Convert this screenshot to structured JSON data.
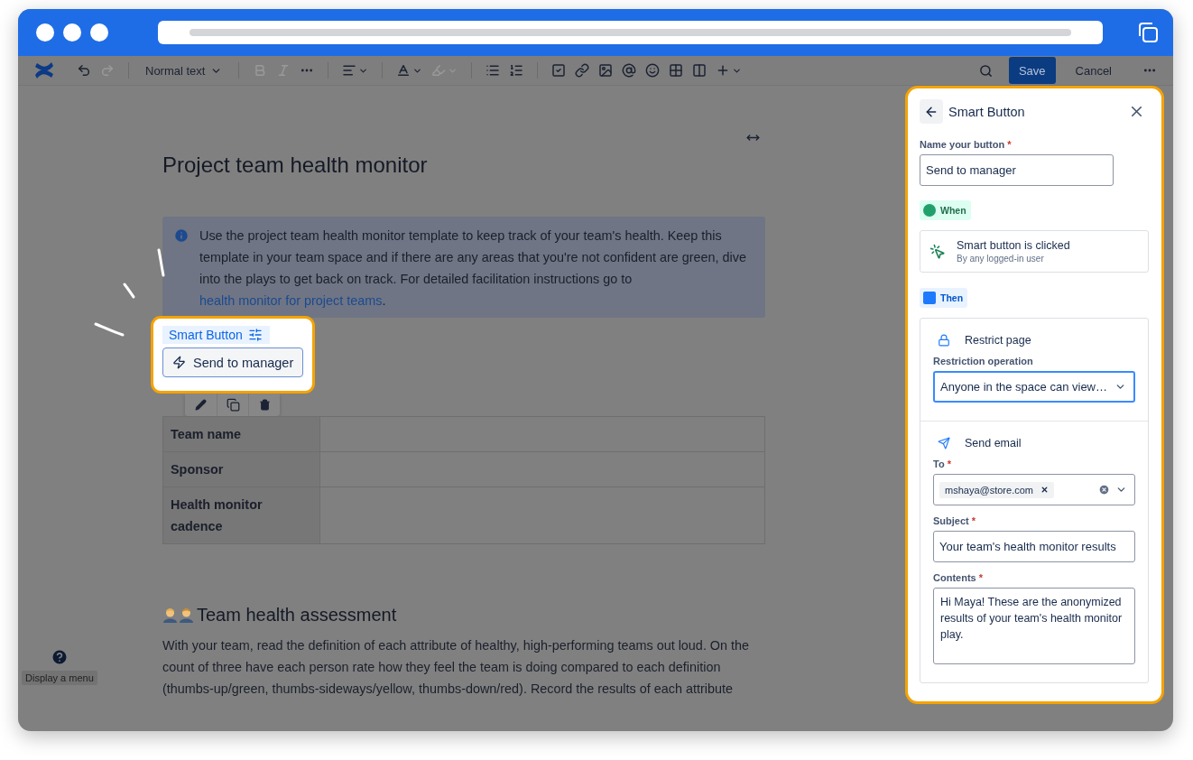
{
  "toolbar": {
    "items": [
      {
        "kind": "logo"
      },
      {
        "kind": "undo",
        "disabled": false
      },
      {
        "kind": "redo",
        "disabled": true
      },
      {
        "kind": "separator"
      },
      {
        "kind": "text_style",
        "label": "Normal text",
        "disabled": false
      },
      {
        "kind": "separator"
      },
      {
        "kind": "bold",
        "disabled": true
      },
      {
        "kind": "italic",
        "disabled": true
      },
      {
        "kind": "more",
        "disabled": false
      },
      {
        "kind": "separator"
      },
      {
        "kind": "align",
        "disabled": false
      },
      {
        "kind": "separator"
      },
      {
        "kind": "text_color",
        "disabled": false
      },
      {
        "kind": "highlight",
        "disabled": true
      },
      {
        "kind": "separator"
      },
      {
        "kind": "bullet_list",
        "disabled": false
      },
      {
        "kind": "numbered_list",
        "disabled": false
      },
      {
        "kind": "separator"
      },
      {
        "kind": "task",
        "disabled": false
      },
      {
        "kind": "link",
        "disabled": false
      },
      {
        "kind": "image",
        "disabled": false
      },
      {
        "kind": "mention",
        "disabled": false
      },
      {
        "kind": "emoji",
        "disabled": false
      },
      {
        "kind": "table",
        "disabled": false
      },
      {
        "kind": "layout",
        "disabled": false
      },
      {
        "kind": "insert",
        "disabled": false
      }
    ],
    "save": "Save",
    "cancel": "Cancel"
  },
  "page": {
    "title": "Project team health monitor",
    "info": {
      "text": "Use the project team health monitor template to keep track of your team's health. Keep this template in your team space and if there are any areas that you're not confident are green, dive into the plays to get back on track. For detailed facilitation instructions go to",
      "link": "health monitor for project teams",
      "after": "."
    },
    "smart_button": {
      "label": "Smart Button",
      "button": "Send to manager"
    },
    "table": {
      "rows": [
        {
          "header": "Team name"
        },
        {
          "header": "Sponsor"
        },
        {
          "header": "Health monitor cadence"
        }
      ]
    },
    "section_title": "Team health assessment",
    "paragraph": "With your team, read the definition of each attribute of healthy, high-performing teams out loud. On the count of three have each person rate how they feel the team is doing compared to each definition (thumbs-up/green, thumbs-sideways/yellow, thumbs-down/red). Record the results of each attribute"
  },
  "help": {
    "tooltip": "Display a menu"
  },
  "panel": {
    "title": "Smart Button",
    "name_field": {
      "label": "Name your button",
      "required_mark": "*",
      "value": "Send to manager"
    },
    "when": {
      "label": "When",
      "trigger": {
        "title": "Smart button is clicked",
        "subtitle": "By any logged-in user"
      }
    },
    "then": {
      "label": "Then",
      "actions": [
        {
          "kind": "restrict",
          "title": "Restrict page",
          "fields": [
            {
              "kind": "select",
              "label": "Restriction operation",
              "focused": true,
              "value": "Anyone in the space can view…"
            }
          ]
        },
        {
          "kind": "email",
          "title": "Send email",
          "fields": [
            {
              "kind": "tags",
              "label": "To",
              "required_mark": "*",
              "focused": false,
              "tags": [
                "mshaya@store.com"
              ]
            },
            {
              "kind": "input",
              "label": "Subject",
              "required_mark": "*",
              "focused": false,
              "value": "Your team's health monitor results"
            },
            {
              "kind": "textarea",
              "label": "Contents",
              "required_mark": "*",
              "focused": false,
              "value": "Hi Maya! These are the anonymized results of your team's health monitor play."
            }
          ]
        }
      ]
    }
  }
}
